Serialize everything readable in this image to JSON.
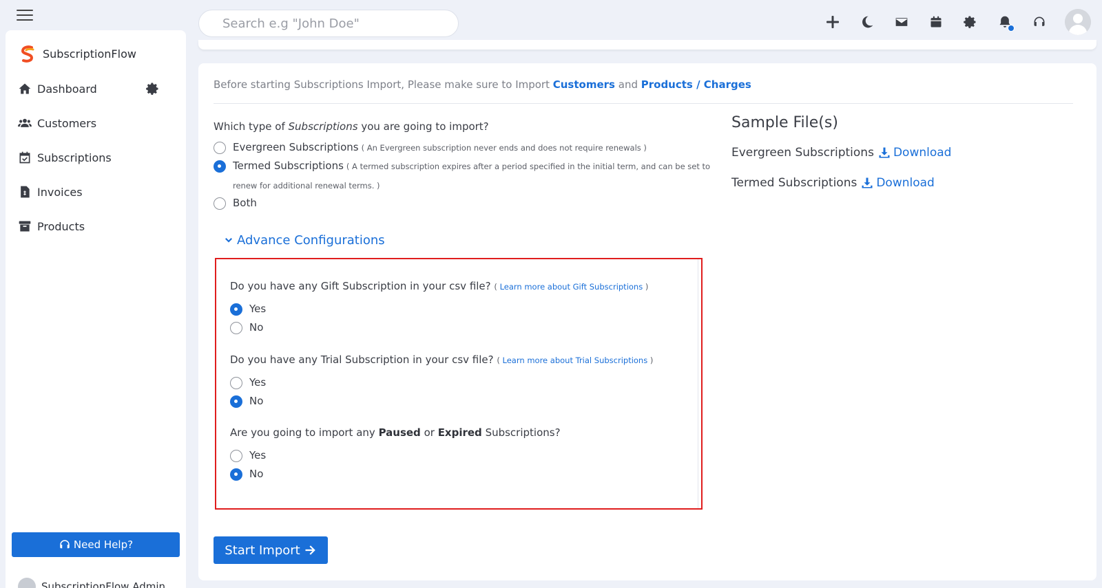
{
  "header": {
    "search_placeholder": "Search e.g \"John Doe\"",
    "icons": [
      "plus-icon",
      "moon-icon",
      "envelope-icon",
      "calendar-icon",
      "gear-icon",
      "bell-icon",
      "headset-icon"
    ]
  },
  "sidebar": {
    "brand": "SubscriptionFlow",
    "items": [
      {
        "label": "Dashboard",
        "icon": "home-icon"
      },
      {
        "label": "Customers",
        "icon": "users-icon"
      },
      {
        "label": "Subscriptions",
        "icon": "calendar-check-icon"
      },
      {
        "label": "Invoices",
        "icon": "invoice-icon"
      },
      {
        "label": "Products",
        "icon": "archive-icon"
      }
    ],
    "help_label": "Need Help?",
    "user_name": "SubscriptionFlow Admin"
  },
  "main": {
    "notice_prefix": "Before starting Subscriptions Import, Please make sure to Import ",
    "notice_customers": "Customers",
    "notice_and": " and ",
    "notice_products": "Products / Charges",
    "type_question_prefix": "Which type of ",
    "type_question_em": "Subscriptions",
    "type_question_suffix": " you are going to import?",
    "types": [
      {
        "label": "Evergreen Subscriptions",
        "hint": "( An Evergreen subscription never ends and does not require renewals )",
        "checked": false
      },
      {
        "label": "Termed Subscriptions",
        "hint": "( A termed subscription expires after a period specified in the initial term, and can be set to renew for additional renewal terms. )",
        "checked": true
      },
      {
        "label": "Both",
        "hint": "",
        "checked": false
      }
    ],
    "advance_label": "Advance Configurations",
    "config": {
      "gift_question": "Do you have any Gift Subscription in your csv file?",
      "gift_link": "Learn more about Gift Subscriptions",
      "trial_question": "Do you have any Trial Subscription in your csv file?",
      "trial_link": "Learn more about Trial Subscriptions",
      "paused_prefix": "Are you going to import any ",
      "paused_bold1": "Paused",
      "paused_or": " or ",
      "paused_bold2": "Expired",
      "paused_suffix": " Subscriptions?",
      "yes": "Yes",
      "no": "No",
      "paren_open": "(",
      "paren_close": ")"
    },
    "start_label": "Start Import",
    "sample_title": "Sample File(s)",
    "samples": [
      {
        "label": "Evergreen Subscriptions",
        "link": "Download"
      },
      {
        "label": "Termed Subscriptions",
        "link": "Download"
      }
    ]
  },
  "colors": {
    "accent": "#1a6fd8",
    "highlight_border": "#e01d1d",
    "background": "#eef1f8"
  }
}
